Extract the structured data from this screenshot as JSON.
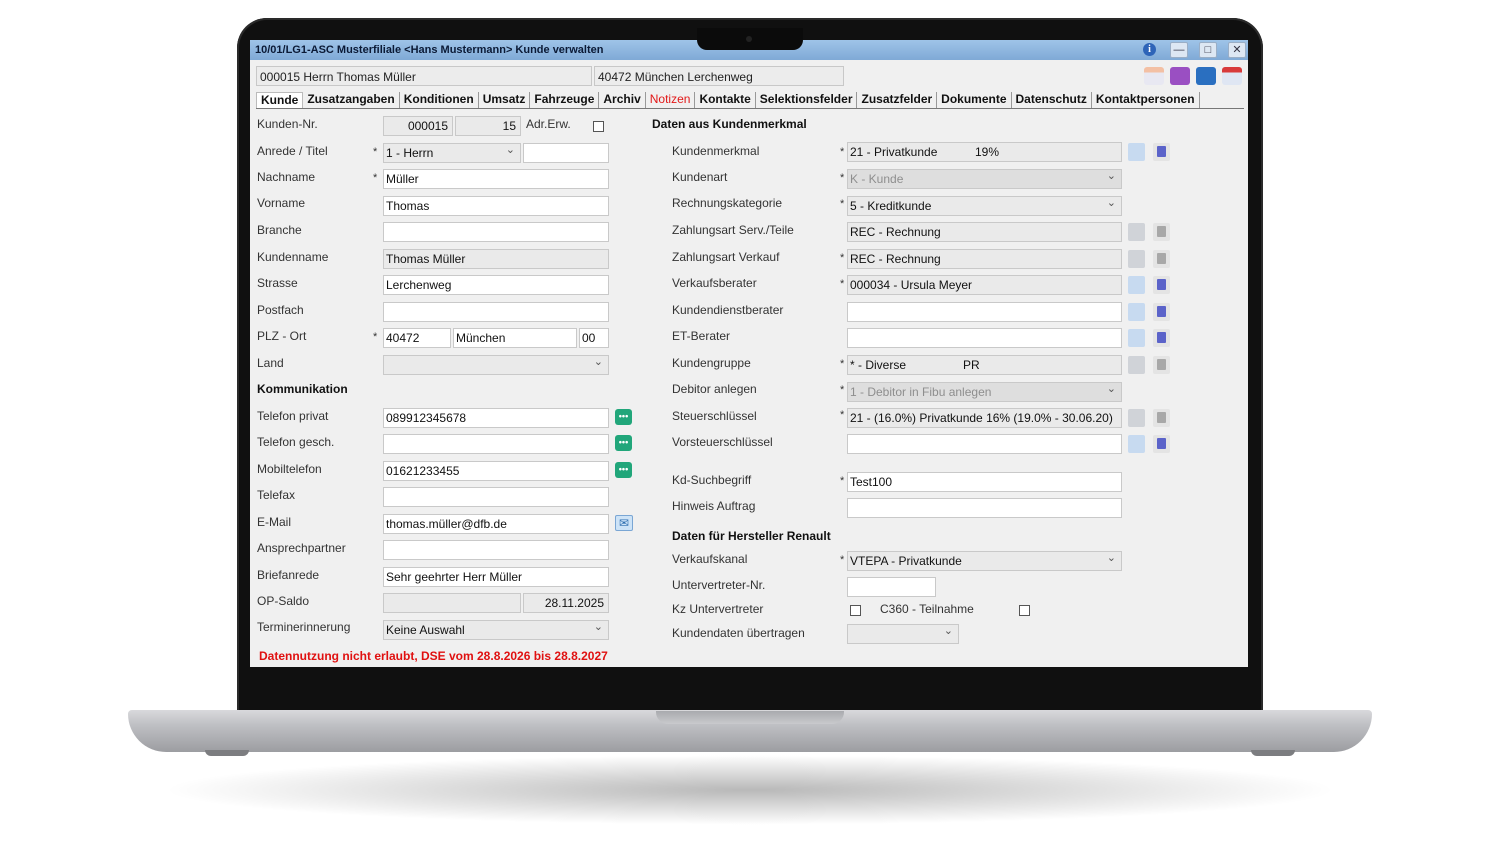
{
  "window": {
    "title": "10/01/LG1-ASC Musterfiliale <Hans Mustermann> Kunde verwalten",
    "info_glyph": "i",
    "minimize_glyph": "—",
    "maximize_glyph": "□",
    "close_glyph": "✕"
  },
  "header": {
    "customer": "000015 Herrn  Thomas Müller",
    "address": "40472 München Lerchenweg"
  },
  "toolbar_icons": [
    "calendar-icon",
    "document-icon",
    "save-icon",
    "calendar-delete-icon"
  ],
  "tabs": [
    "Kunde",
    "Zusatzangaben",
    "Konditionen",
    "Umsatz",
    "Fahrzeuge",
    "Archiv",
    "Notizen",
    "Kontakte",
    "Selektionsfelder",
    "Zusatzfelder",
    "Dokumente",
    "Datenschutz",
    "Kontaktpersonen"
  ],
  "left": {
    "kundennr_label": "Kunden-Nr.",
    "kundennr": "000015",
    "kundennr_suffix": "15",
    "adr_erw_label": "Adr.Erw.",
    "anrede_label": "Anrede / Titel",
    "anrede": "1 - Herrn",
    "titel": "",
    "nachname_label": "Nachname",
    "nachname": "Müller",
    "vorname_label": "Vorname",
    "vorname": "Thomas",
    "branche_label": "Branche",
    "branche": "",
    "kundenname_label": "Kundenname",
    "kundenname": "Thomas Müller",
    "strasse_label": "Strasse",
    "strasse": "Lerchenweg",
    "postfach_label": "Postfach",
    "postfach": "",
    "plzort_label": "PLZ - Ort",
    "plz": "40472",
    "ort": "München",
    "ort_code": "00",
    "land_label": "Land",
    "land": "",
    "kommunikation_title": "Kommunikation",
    "tel_privat_label": "Telefon privat",
    "tel_privat": "089912345678",
    "tel_gesch_label": "Telefon gesch.",
    "tel_gesch": "",
    "mobil_label": "Mobiltelefon",
    "mobil": "01621233455",
    "telefax_label": "Telefax",
    "telefax": "",
    "email_label": "E-Mail",
    "email": "thomas.müller@dfb.de",
    "ansprech_label": "Ansprechpartner",
    "ansprech": "",
    "brief_label": "Briefanrede",
    "brief": "Sehr geehrter Herr Müller",
    "opsaldo_label": "OP-Saldo",
    "opsaldo": "",
    "opsaldo_date": "28.11.2025",
    "termin_label": "Terminerinnerung",
    "termin": "Keine Auswahl",
    "required_mark": "*",
    "chat_glyph": "•••",
    "mail_glyph": "✉"
  },
  "right": {
    "title": "Daten aus Kundenmerkmal",
    "kundenmerkmal_label": "Kundenmerkmal",
    "kundenmerkmal": "21 - Privatkunde",
    "kundenmerkmal_pct": "19%",
    "kundenart_label": "Kundenart",
    "kundenart": "K - Kunde",
    "rechnungskat_label": "Rechnungskategorie",
    "rechnungskat": "5 - Kreditkunde",
    "zahl_serv_label": "Zahlungsart Serv./Teile",
    "zahl_serv": "REC - Rechnung",
    "zahl_verk_label": "Zahlungsart Verkauf",
    "zahl_verk": "REC - Rechnung",
    "verkaufsberater_label": "Verkaufsberater",
    "verkaufsberater": "000034 - Ursula Meyer",
    "kundendienst_label": "Kundendienstberater",
    "kundendienst": "",
    "etberater_label": "ET-Berater",
    "etberater": "",
    "kundengruppe_label": "Kundengruppe",
    "kundengruppe": "* - Diverse",
    "kundengruppe_code": "PR",
    "debitor_label": "Debitor anlegen",
    "debitor": "1 - Debitor in Fibu anlegen",
    "steuer_label": "Steuerschlüssel",
    "steuer": "21 - (16.0%) Privatkunde 16% (19.0% - 30.06.20)",
    "vorsteuer_label": "Vorsteuerschlüssel",
    "vorsteuer": "",
    "suchbegriff_label": "Kd-Suchbegriff",
    "suchbegriff": "Test100",
    "hinweis_label": "Hinweis Auftrag",
    "hinweis": "",
    "hersteller_title": "Daten für Hersteller Renault",
    "verkaufskanal_label": "Verkaufskanal",
    "verkaufskanal": "VTEPA - Privatkunde",
    "untervertreter_nr_label": "Untervertreter-Nr.",
    "untervertreter_nr": "",
    "kz_untervertreter_label": "Kz Untervertreter",
    "c360_label": "C360 - Teilnahme",
    "kundendaten_label": "Kundendaten übertragen",
    "kundendaten": ""
  },
  "warning": "Datennutzung nicht erlaubt, DSE vom 28.8.2026 bis 28.8.2027",
  "colors": {
    "titlebar": "#8fb6df",
    "tab_alert": "#e21818",
    "warning": "#e01010",
    "chat_icon": "#21a67a",
    "trash_icon": "#5b63c9"
  }
}
